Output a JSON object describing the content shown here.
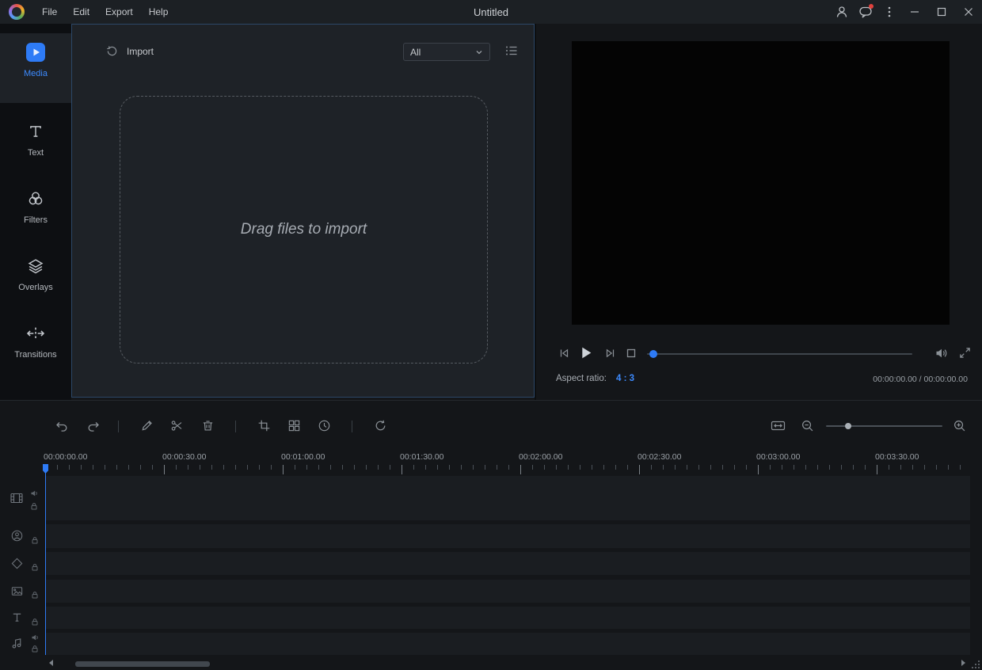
{
  "titlebar": {
    "title": "Untitled",
    "menus": [
      {
        "label": "File"
      },
      {
        "label": "Edit"
      },
      {
        "label": "Export"
      },
      {
        "label": "Help"
      }
    ]
  },
  "sidebar": {
    "active_item": "Media",
    "items": [
      {
        "label": "Media"
      },
      {
        "label": "Text"
      },
      {
        "label": "Filters"
      },
      {
        "label": "Overlays"
      },
      {
        "label": "Transitions"
      }
    ]
  },
  "media_panel": {
    "import_label": "Import",
    "filter_dropdown": {
      "value": "All"
    },
    "drop_hint": "Drag files to import"
  },
  "preview": {
    "aspect_ratio_label": "Aspect ratio:",
    "aspect_ratio_value": "4 : 3",
    "timecode_display": "00:00:00.00 / 00:00:00.00"
  },
  "timeline": {
    "ruler_labels": [
      "00:00:00.00",
      "00:00:30.00",
      "00:01:00.00",
      "00:01:30.00",
      "00:02:00.00",
      "00:02:30.00",
      "00:03:00.00",
      "00:03:30.00"
    ],
    "tracks": [
      {
        "name": "video"
      },
      {
        "name": "pip"
      },
      {
        "name": "overlay"
      },
      {
        "name": "image"
      },
      {
        "name": "text"
      },
      {
        "name": "audio"
      }
    ]
  },
  "colors": {
    "accent": "#3d8bff",
    "notification_dot": "#e0413d"
  }
}
